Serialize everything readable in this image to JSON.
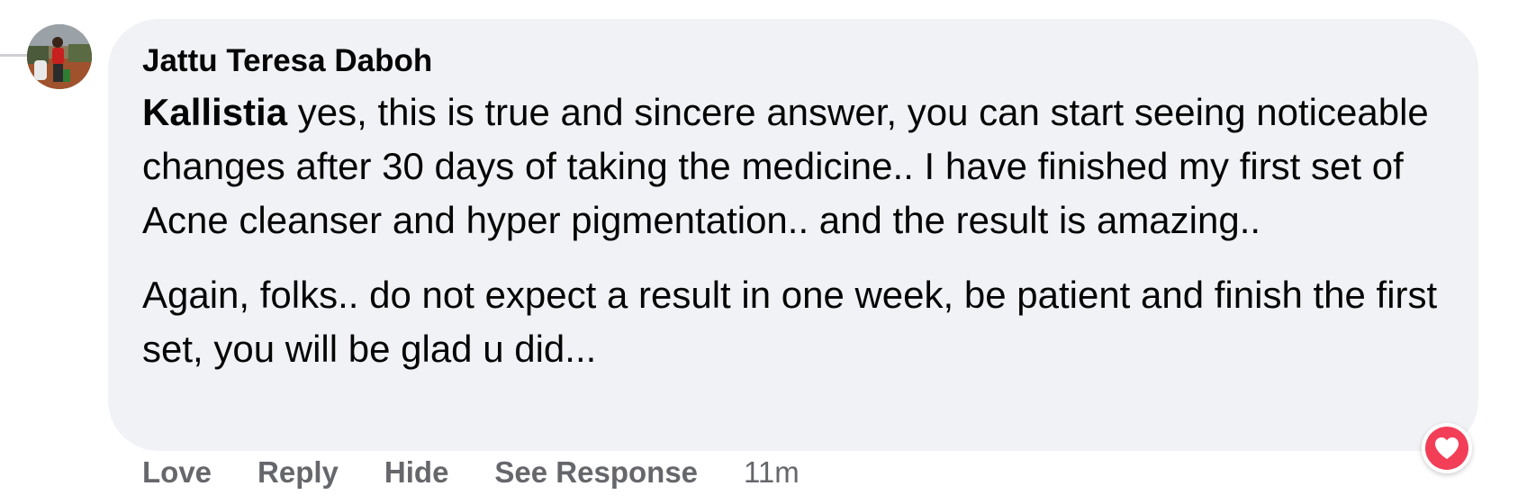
{
  "comment": {
    "author": "Jattu Teresa Daboh",
    "mention": "Kallistia",
    "paragraph_1_rest": " yes, this is true and sincere answer, you can start seeing noticeable changes after 30 days of taking the medicine.. I have finished my first set of Acne cleanser and hyper pigmentation.. and the result is amazing..",
    "paragraph_2": "Again, folks.. do not expect a result in one week, be patient and finish the first set, you will be glad u did..."
  },
  "actions": {
    "love": "Love",
    "reply": "Reply",
    "hide": "Hide",
    "see_response": "See Response",
    "timestamp": "11m"
  },
  "reaction": {
    "icon": "heart-icon",
    "color": "#f33e58"
  },
  "colors": {
    "bubble": "#f0f2f5",
    "action_text": "#65676b",
    "text": "#050505"
  }
}
